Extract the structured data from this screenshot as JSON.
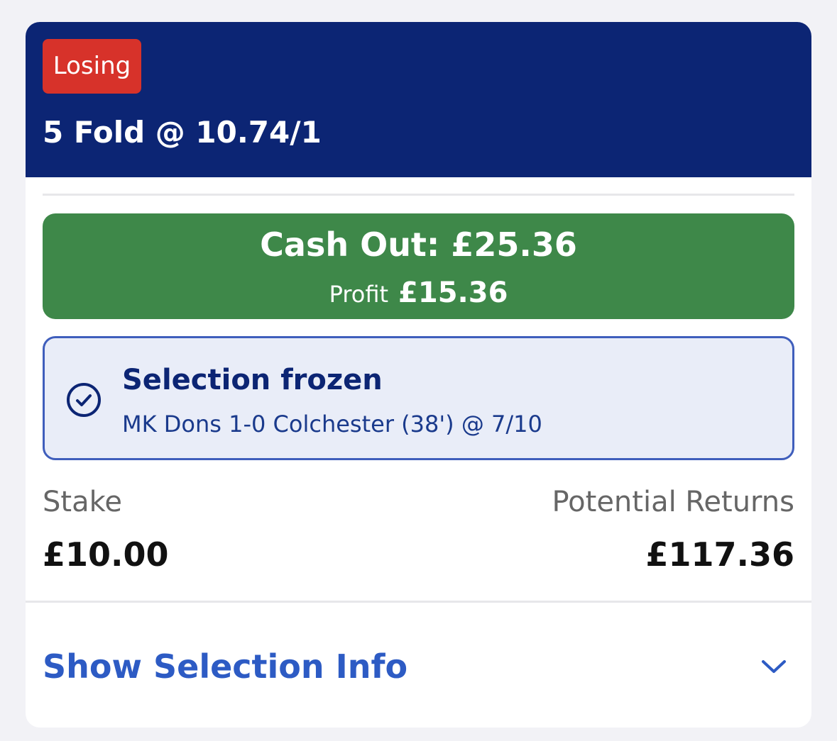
{
  "bet": {
    "status": "Losing",
    "title": "5 Fold @ 10.74/1"
  },
  "cashout": {
    "label": "Cash Out: £25.36",
    "profit_label": "Profit",
    "profit_value": "£15.36"
  },
  "frozen": {
    "title": "Selection frozen",
    "detail": "MK Dons 1-0 Colchester (38') @ 7/10",
    "icon": "check-circle-icon"
  },
  "stake": {
    "label": "Stake",
    "value": "£10.00"
  },
  "returns": {
    "label": "Potential Returns",
    "value": "£117.36"
  },
  "selection_info": {
    "label": "Show Selection Info",
    "icon": "chevron-down-icon"
  },
  "colors": {
    "header": "#0c2574",
    "status_losing": "#d7322a",
    "cashout_green": "#3e8849",
    "frozen_bg": "#e9edf8",
    "frozen_border": "#3f5ebc",
    "link_blue": "#2d5bc4"
  }
}
